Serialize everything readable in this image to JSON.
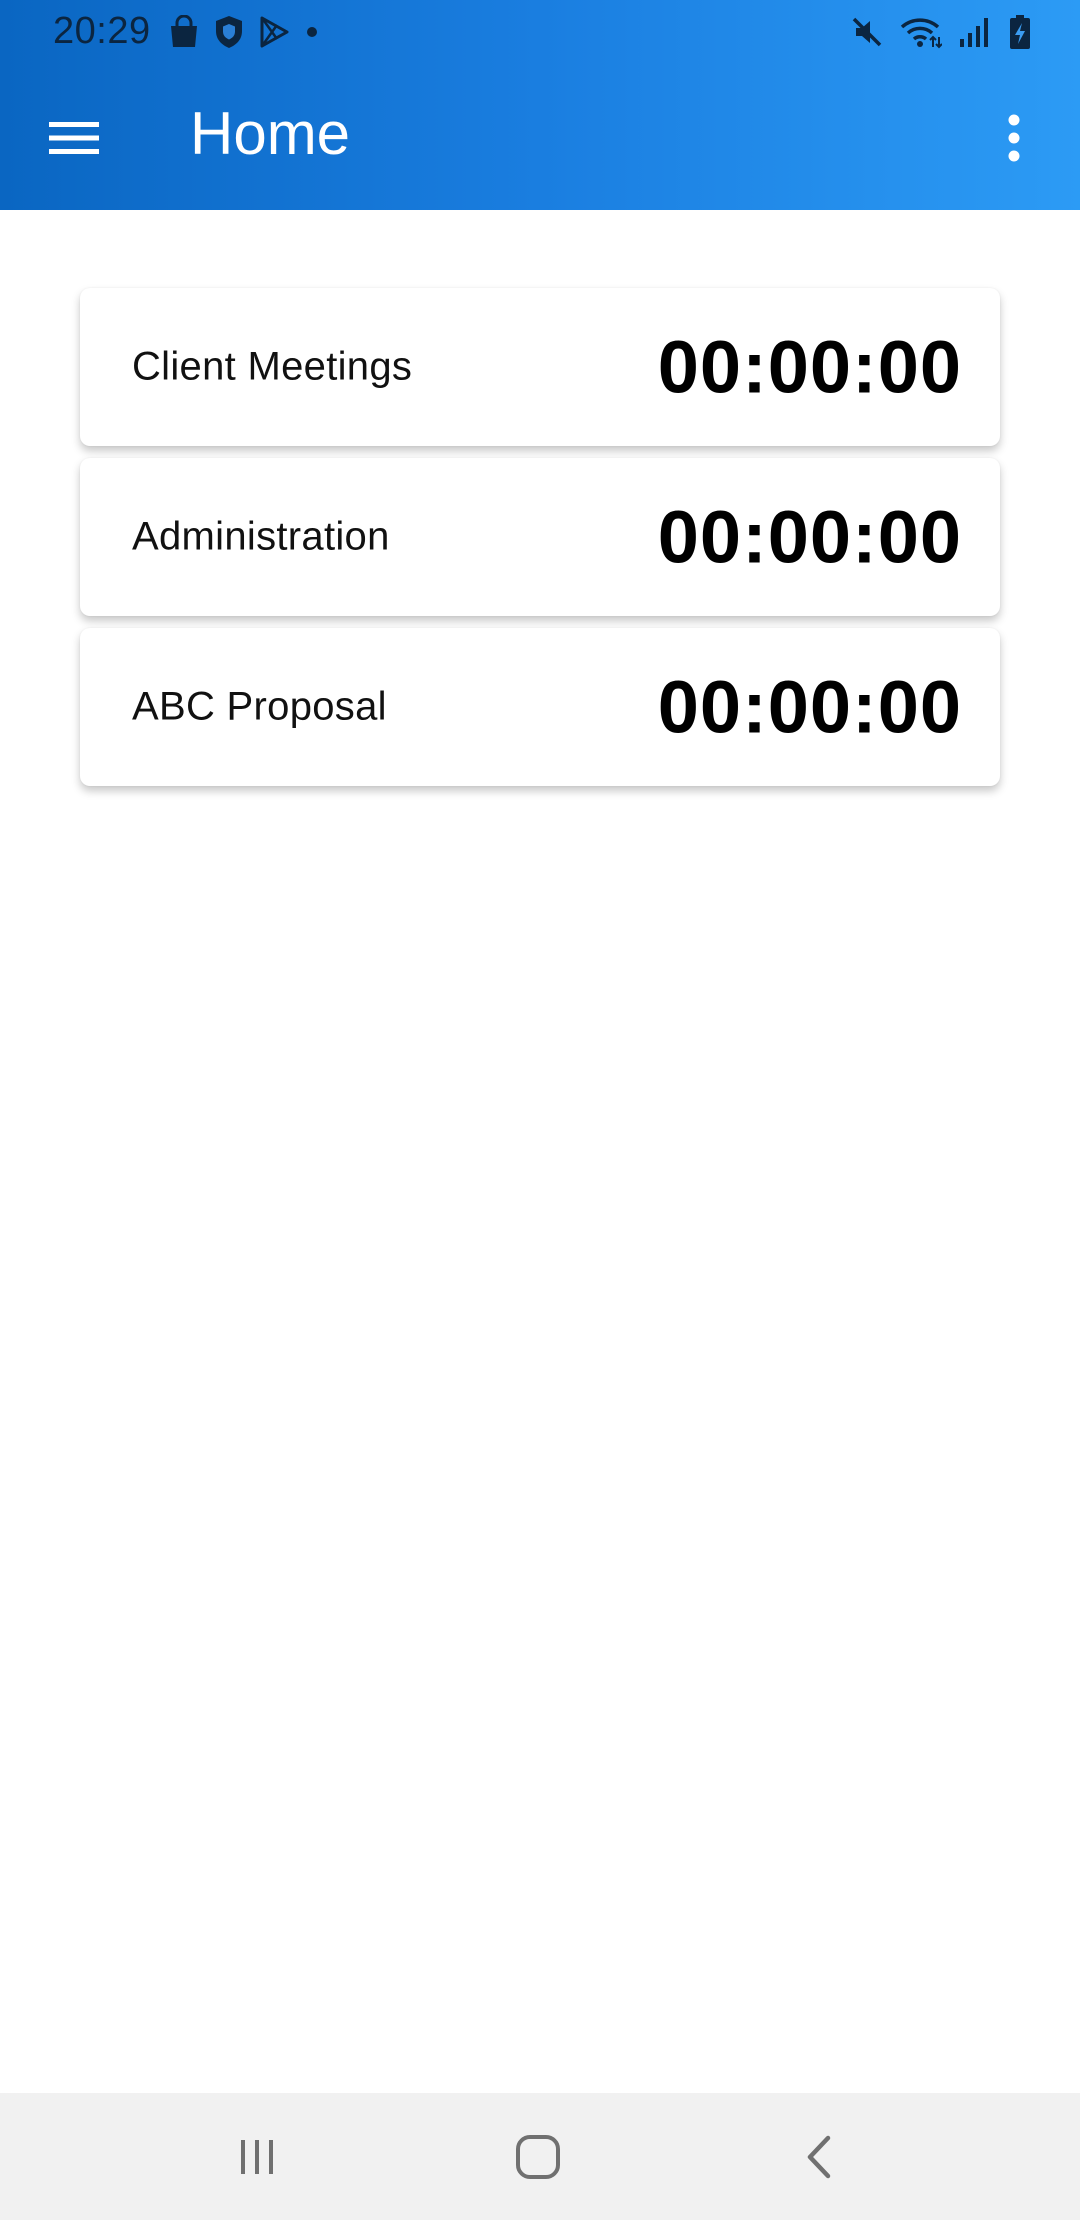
{
  "status_bar": {
    "time": "20:29",
    "left_icons": [
      "shopping-bag-icon",
      "shield-icon",
      "play-store-icon",
      "notification-dot-icon"
    ],
    "right_icons": [
      "mute-icon",
      "wifi-icon",
      "signal-icon",
      "battery-charging-icon"
    ]
  },
  "app_bar": {
    "title": "Home",
    "menu_icon": "hamburger-menu-icon",
    "overflow_icon": "more-vertical-icon"
  },
  "cards": [
    {
      "label": "Client Meetings",
      "time": "00:00:00"
    },
    {
      "label": "Administration",
      "time": "00:00:00"
    },
    {
      "label": "ABC Proposal",
      "time": "00:00:00"
    }
  ],
  "nav_bar": {
    "buttons": [
      "recent-apps-icon",
      "home-icon",
      "back-icon"
    ]
  },
  "colors": {
    "header_start": "#0a66c2",
    "header_end": "#2c9bf5",
    "nav_background": "#f1f1f1",
    "card_background": "#ffffff"
  }
}
